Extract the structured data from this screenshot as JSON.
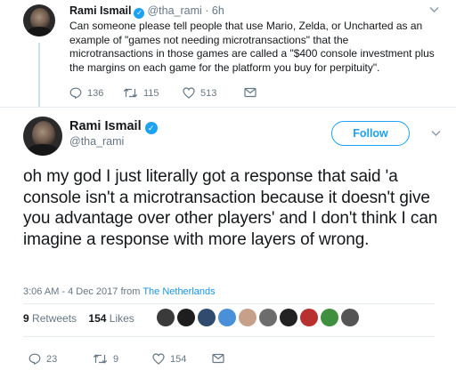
{
  "parent_tweet": {
    "name": "Rami Ismail",
    "handle_time": "@tha_rami · 6h",
    "text": "Can someone please tell people that use Mario, Zelda, or Uncharted as an example of \"games not needing microtransactions\" that the microtransactions in those games are called a \"$400 console investment plus the margins on each game for the platform you buy for perpituity\".",
    "replies": "136",
    "retweets": "115",
    "likes": "513"
  },
  "main_tweet": {
    "name": "Rami Ismail",
    "handle": "@tha_rami",
    "follow_label": "Follow",
    "text": "oh my god I just literally got a response that said 'a console isn't a microtransaction because it doesn't give you advantage over other players' and I don't think I can imagine a response with more layers of wrong.",
    "timestamp": "3:06 AM - 4 Dec 2017 from ",
    "location": "The Netherlands",
    "retweets_count": "9",
    "retweets_label": "Retweets",
    "likes_count": "154",
    "likes_label": "Likes",
    "replies": "23",
    "retweets": "9",
    "likes": "154"
  },
  "liker_avatars": [
    "#3a3a3a",
    "#1e1e1e",
    "#2f4b6e",
    "#4a90d9",
    "#c7a08a",
    "#6c6c6c",
    "#222222",
    "#b8312f",
    "#3f8f3f",
    "#555555"
  ],
  "icons": [
    "reply-icon",
    "retweet-icon",
    "like-icon",
    "message-icon",
    "chevron-down-icon",
    "verified-badge-icon"
  ]
}
